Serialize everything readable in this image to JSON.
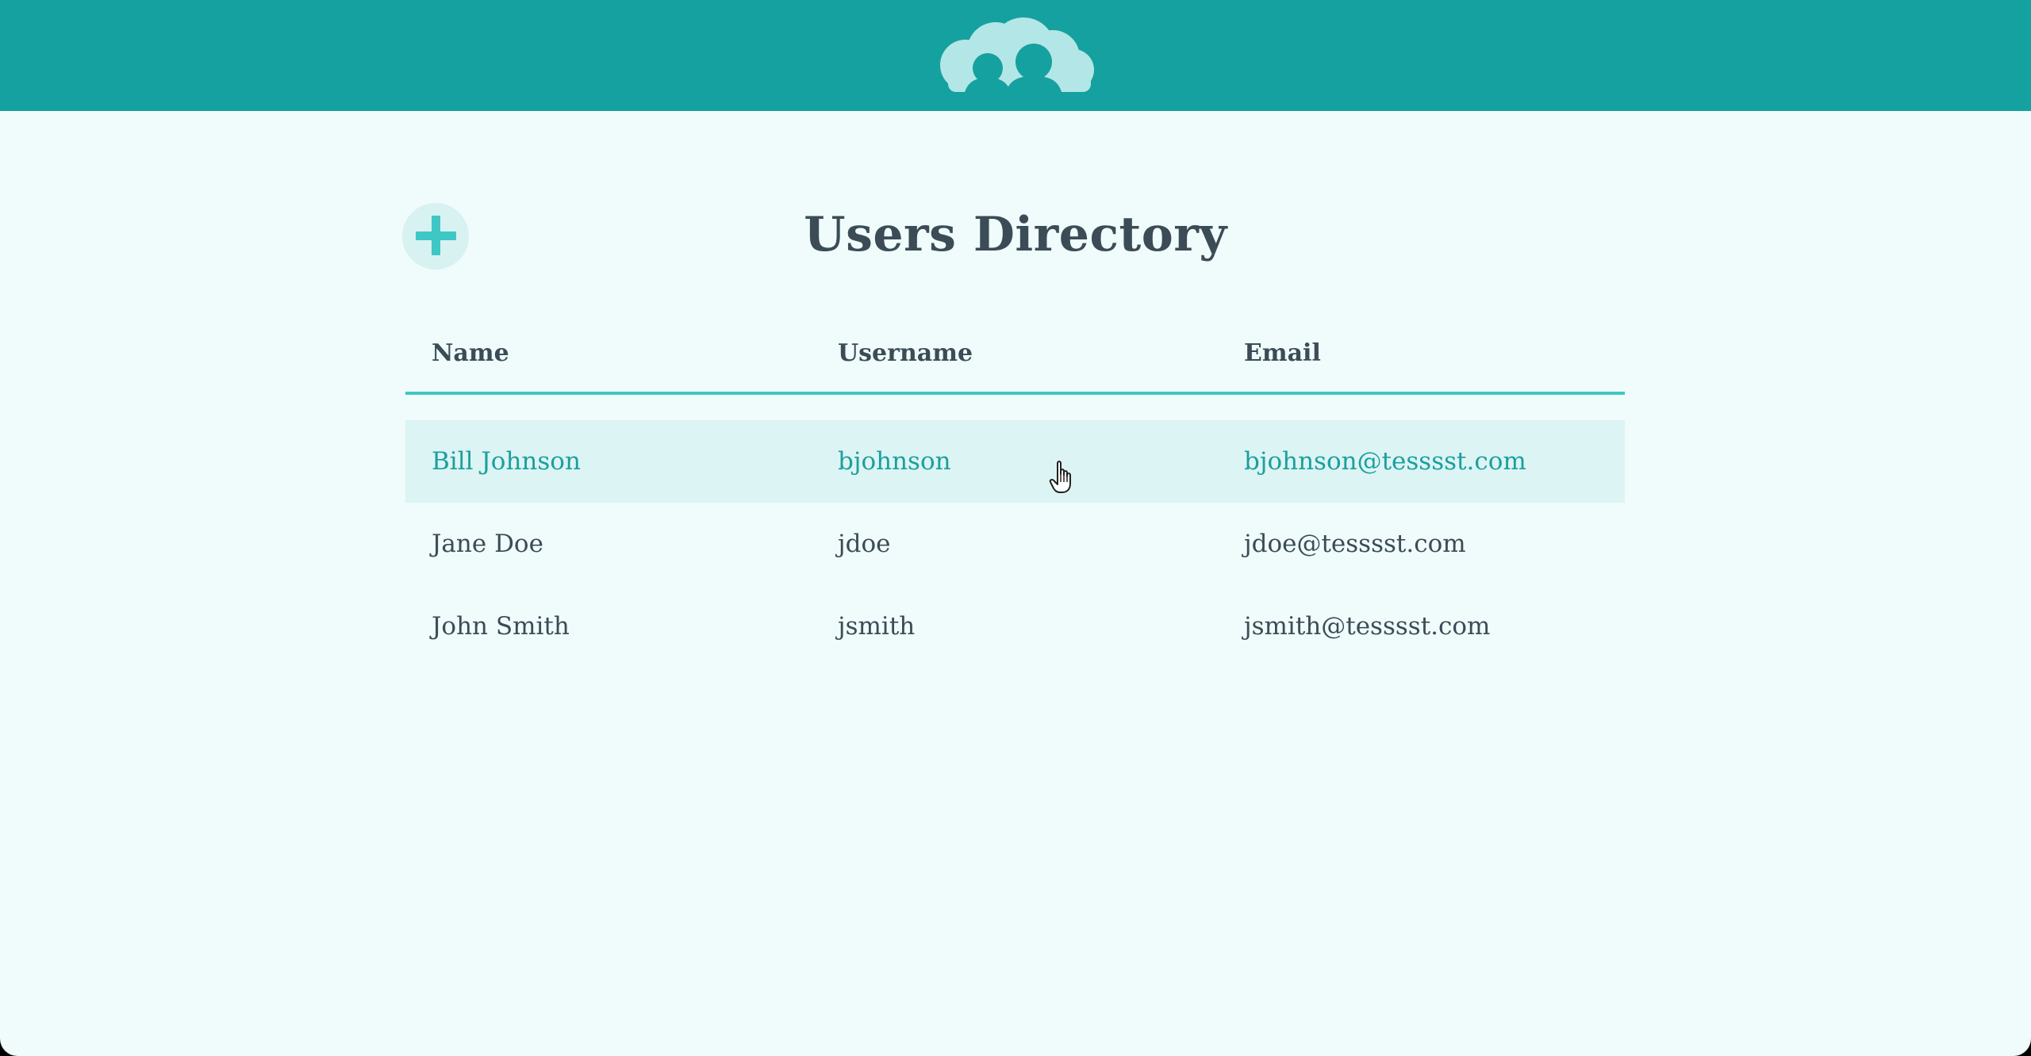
{
  "page": {
    "title": "Users Directory"
  },
  "header": {
    "logo_icon": "users-cloud-icon"
  },
  "actions": {
    "add_icon": "plus-icon"
  },
  "table": {
    "columns": [
      "Name",
      "Username",
      "Email"
    ],
    "rows": [
      {
        "name": "Bill Johnson",
        "username": "bjohnson",
        "email": "bjohnson@tesssst.com",
        "hovered": true
      },
      {
        "name": "Jane Doe",
        "username": "jdoe",
        "email": "jdoe@tesssst.com",
        "hovered": false
      },
      {
        "name": "John Smith",
        "username": "jsmith",
        "email": "jsmith@tesssst.com",
        "hovered": false
      }
    ]
  },
  "colors": {
    "header_bg": "#15a19f",
    "page_bg": "#effcfb",
    "accent": "#3ec7c4",
    "text": "#3c4c56",
    "hover_row_bg": "#ddf4f4",
    "hover_text": "#1aa09e"
  }
}
